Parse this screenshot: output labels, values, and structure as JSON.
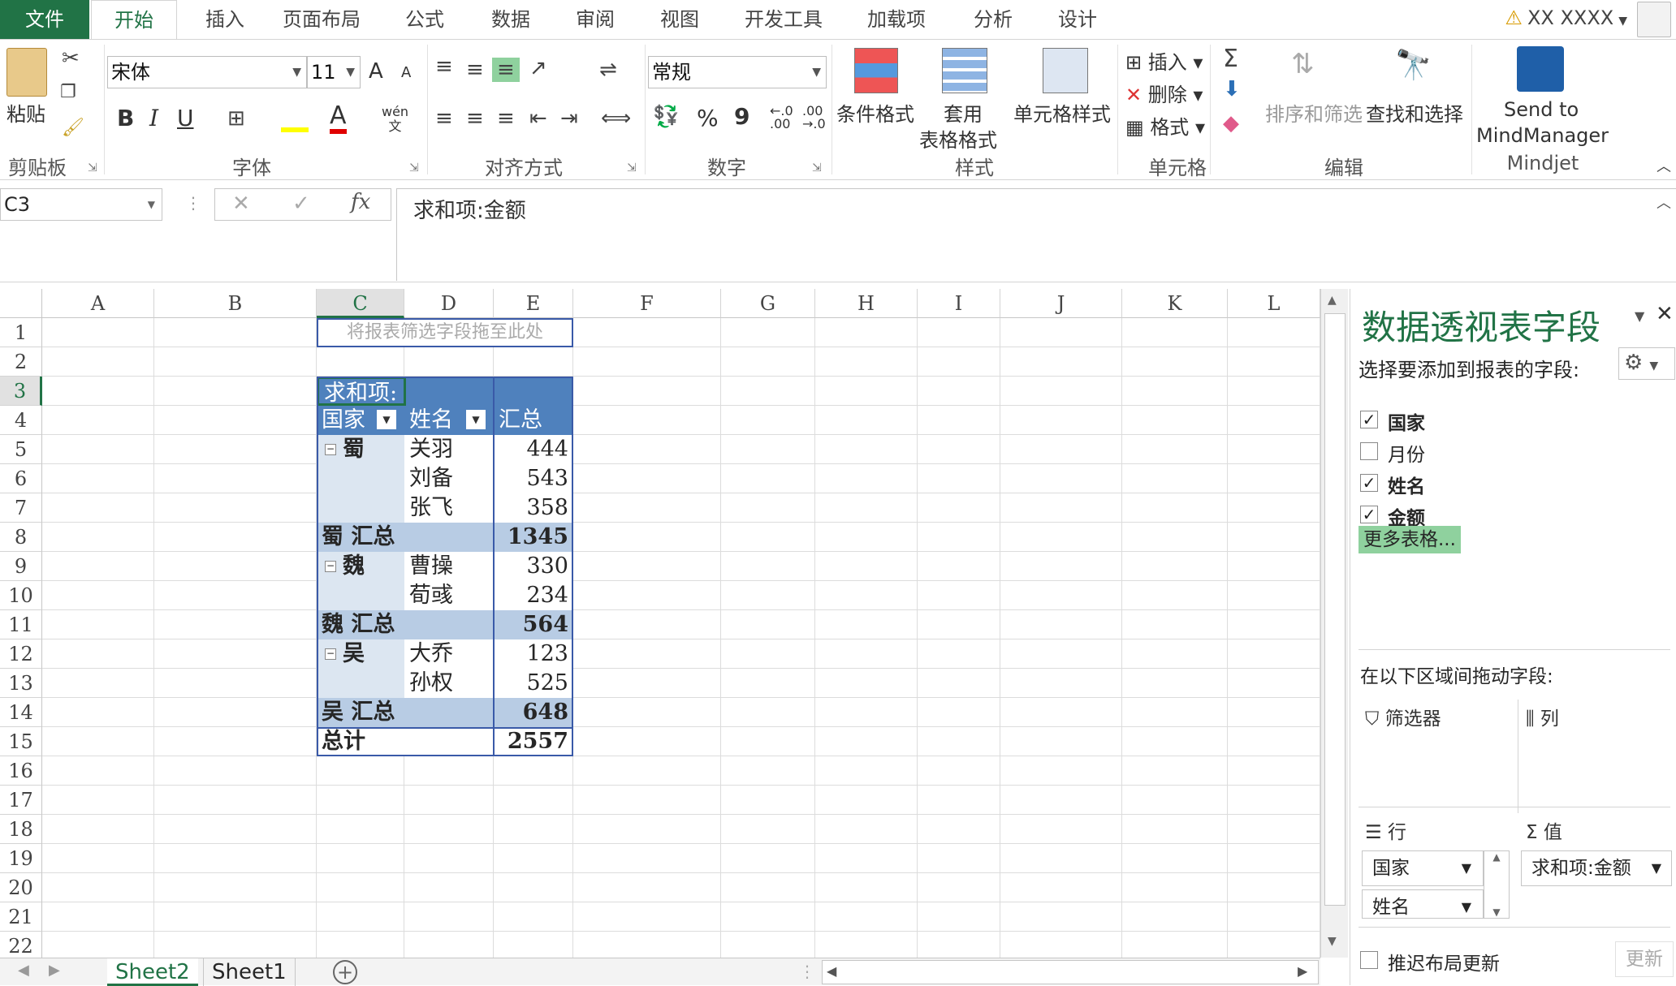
{
  "tabs": [
    "文件",
    "开始",
    "插入",
    "页面布局",
    "公式",
    "数据",
    "审阅",
    "视图",
    "开发工具",
    "加载项",
    "分析",
    "设计"
  ],
  "user": "XX XXXX",
  "ribbon": {
    "paste": "粘贴",
    "clipboard": "剪贴板",
    "font_name": "宋体",
    "font_size": "11",
    "font_grow": "A",
    "font_shrink": "A",
    "bold": "B",
    "italic": "I",
    "underline": "U",
    "font_group": "字体",
    "wen": "wén\n文",
    "align_group": "对齐方式",
    "number_format": "常规",
    "percent": "%",
    "comma": "9",
    "number_group": "数字",
    "cond_format": "条件格式",
    "table_format_1": "套用",
    "table_format_2": "表格格式",
    "cell_style": "单元格样式",
    "styles_group": "样式",
    "insert": "插入",
    "delete": "删除",
    "format": "格式",
    "cells_group": "单元格",
    "sort_filter": "排序和筛选",
    "find_select": "查找和选择",
    "edit_group": "编辑",
    "mindmanager_1": "Send to",
    "mindmanager_2": "MindManager",
    "mindjet_group": "Mindjet"
  },
  "formula": {
    "namebox": "C3",
    "cancel": "✕",
    "enter": "✓",
    "fx": "fx",
    "content": "求和项:金额"
  },
  "columns": [
    "A",
    "B",
    "C",
    "D",
    "E",
    "F",
    "G",
    "H",
    "I",
    "J",
    "K",
    "L"
  ],
  "rows": [
    "1",
    "2",
    "3",
    "4",
    "5",
    "6",
    "7",
    "8",
    "9",
    "10",
    "11",
    "12",
    "13",
    "14",
    "15",
    "16",
    "17",
    "18",
    "19",
    "20",
    "21",
    "22"
  ],
  "pivot": {
    "filter_hint": "将报表筛选字段拖至此处",
    "value_header": "求和项:",
    "col_country": "国家",
    "col_name": "姓名",
    "col_total": "汇总",
    "rows": [
      {
        "country": "蜀",
        "name": "关羽",
        "value": "444"
      },
      {
        "country": "",
        "name": "刘备",
        "value": "543"
      },
      {
        "country": "",
        "name": "张飞",
        "value": "358"
      },
      {
        "subtotal": "蜀 汇总",
        "value": "1345"
      },
      {
        "country": "魏",
        "name": "曹操",
        "value": "330"
      },
      {
        "country": "",
        "name": "荀彧",
        "value": "234"
      },
      {
        "subtotal": "魏 汇总",
        "value": "564"
      },
      {
        "country": "吴",
        "name": "大乔",
        "value": "123"
      },
      {
        "country": "",
        "name": "孙权",
        "value": "525"
      },
      {
        "subtotal": "吴 汇总",
        "value": "648"
      },
      {
        "grand": "总计",
        "value": "2557"
      }
    ]
  },
  "sheets": [
    "Sheet2",
    "Sheet1"
  ],
  "pane": {
    "title": "数据透视表字段",
    "subtitle": "选择要添加到报表的字段:",
    "fields": [
      {
        "label": "国家",
        "checked": true
      },
      {
        "label": "月份",
        "checked": false
      },
      {
        "label": "姓名",
        "checked": true
      },
      {
        "label": "金额",
        "checked": true
      }
    ],
    "more_tables": "更多表格...",
    "drag_label": "在以下区域间拖动字段:",
    "filters": "筛选器",
    "columns": "列",
    "rows": "行",
    "values": "值",
    "row_items": [
      "国家",
      "姓名"
    ],
    "value_item": "求和项:金额",
    "defer": "推迟布局更新",
    "update": "更新"
  },
  "colors": {
    "accent": "#217346",
    "pivot_header": "#4f81bd",
    "pivot_light": "#dce6f1",
    "pivot_mid": "#b8cce4"
  }
}
